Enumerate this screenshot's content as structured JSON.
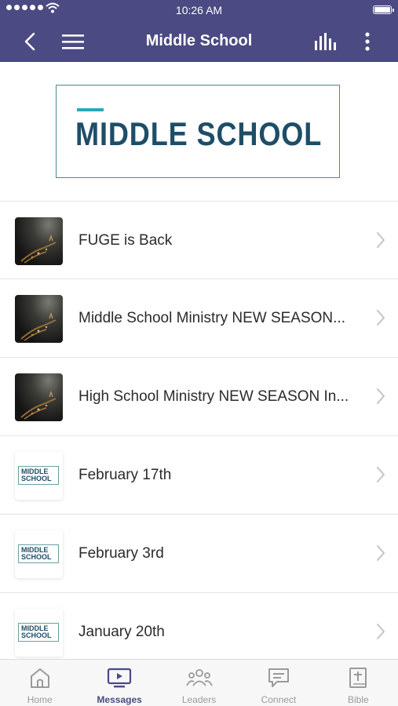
{
  "status_bar": {
    "time": "10:26 AM"
  },
  "header": {
    "title": "Middle School"
  },
  "banner": {
    "logo_text": "MIDDLE SCHOOL"
  },
  "items": [
    {
      "title": "FUGE is Back",
      "thumb": "photo"
    },
    {
      "title": "Middle School Ministry NEW SEASON...",
      "thumb": "photo"
    },
    {
      "title": "High School Ministry NEW SEASON In...",
      "thumb": "photo"
    },
    {
      "title": "February 17th",
      "thumb": "logo"
    },
    {
      "title": "February 3rd",
      "thumb": "logo"
    },
    {
      "title": "January 20th",
      "thumb": "logo"
    }
  ],
  "thumb_logo_text": [
    "MIDDLE",
    "SCHOOL"
  ],
  "tabs": [
    {
      "label": "Home",
      "icon": "home-icon"
    },
    {
      "label": "Messages",
      "icon": "tv-play-icon",
      "active": true
    },
    {
      "label": "Leaders",
      "icon": "people-icon"
    },
    {
      "label": "Connect",
      "icon": "chat-icon"
    },
    {
      "label": "Bible",
      "icon": "bible-icon"
    }
  ],
  "colors": {
    "header_bg": "#4b4a82",
    "active_tab": "#4b4a82",
    "inactive_tab": "#9a9a9a",
    "logo_text": "#1f4d67",
    "logo_accent": "#2aa9b5"
  }
}
